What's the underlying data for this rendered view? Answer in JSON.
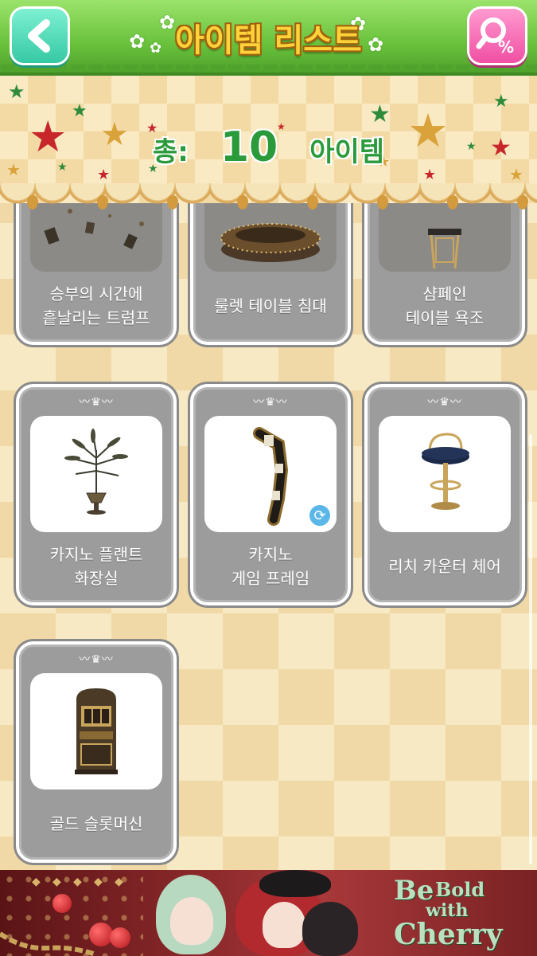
{
  "header": {
    "title": "아이템 리스트",
    "back_icon": "chevron-left-icon",
    "search_icon": "search-percent-icon"
  },
  "summary": {
    "total_label": "총:",
    "total_count": "10",
    "unit_label": "아이템"
  },
  "items": [
    {
      "name": "승부의 시간에\n흩날리는 트럼프"
    },
    {
      "name": "룰렛 테이블 침대"
    },
    {
      "name": "샴페인\n테이블 욕조"
    },
    {
      "name": "카지노 플랜트\n화장실"
    },
    {
      "name": "카지노\n게임 프레임",
      "badge_icon": "refresh-icon"
    },
    {
      "name": "리치 카운터 체어"
    },
    {
      "name": "골드 슬롯머신"
    }
  ],
  "ad": {
    "line_be": "Be",
    "line_bold": "Bold",
    "line_with": "with",
    "line_cherry": "Cherry"
  },
  "colors": {
    "header_green": "#6ac23c",
    "accent_green": "#2a9a3b",
    "card_gray": "#9c9c9c"
  }
}
